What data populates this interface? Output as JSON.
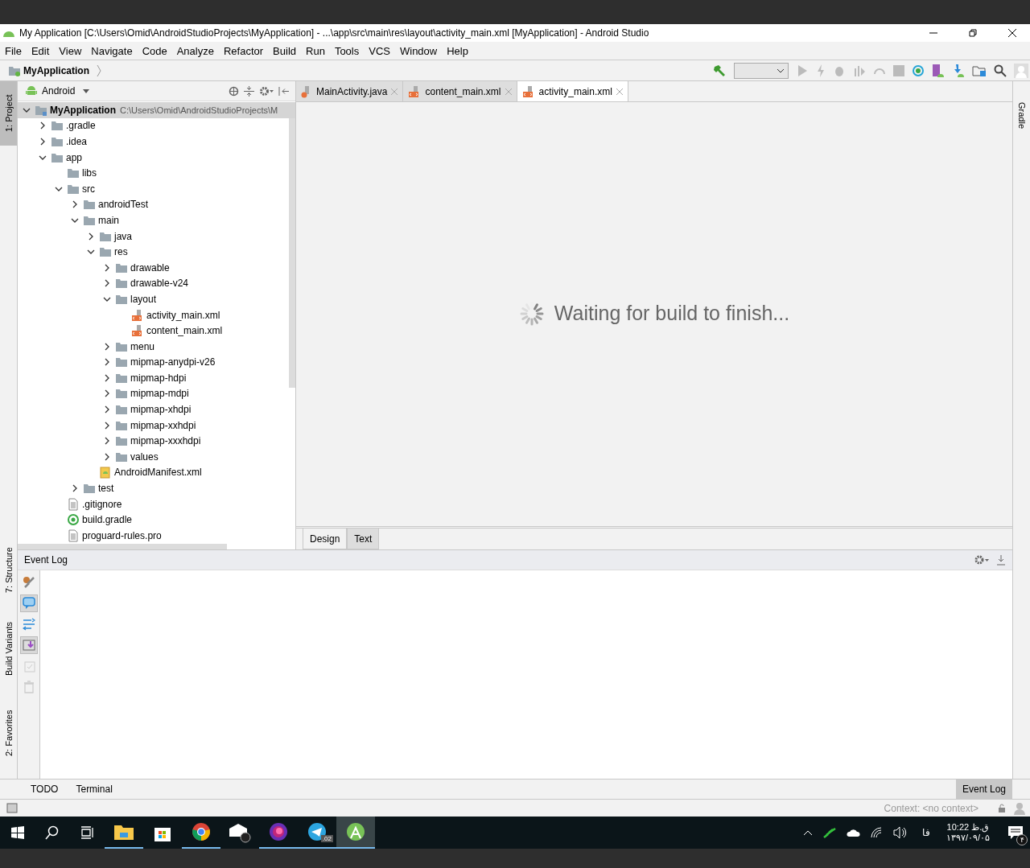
{
  "window": {
    "title": "My Application [C:\\Users\\Omid\\AndroidStudioProjects\\MyApplication] - ...\\app\\src\\main\\res\\layout\\activity_main.xml [MyApplication] - Android Studio"
  },
  "menu": [
    "File",
    "Edit",
    "View",
    "Navigate",
    "Code",
    "Analyze",
    "Refactor",
    "Build",
    "Run",
    "Tools",
    "VCS",
    "Window",
    "Help"
  ],
  "breadcrumb": "MyApplication",
  "left_strip": [
    {
      "label": "1: Project",
      "selected": true
    },
    {
      "label": "7: Structure",
      "selected": false
    },
    {
      "label": "Build Variants",
      "selected": false
    },
    {
      "label": "2: Favorites",
      "selected": false
    }
  ],
  "right_strip": [
    {
      "label": "Gradle",
      "selected": false
    }
  ],
  "project_panel": {
    "view": "Android",
    "tree": [
      {
        "label": "MyApplication",
        "path": "C:\\Users\\Omid\\AndroidStudioProjects\\M",
        "kind": "module",
        "expanded": true,
        "selected": true,
        "children": [
          {
            "label": ".gradle",
            "kind": "folder",
            "expanded": false
          },
          {
            "label": ".idea",
            "kind": "folder",
            "expanded": false
          },
          {
            "label": "app",
            "kind": "folder",
            "expanded": true,
            "children": [
              {
                "label": "libs",
                "kind": "folder"
              },
              {
                "label": "src",
                "kind": "folder",
                "expanded": true,
                "children": [
                  {
                    "label": "androidTest",
                    "kind": "folder",
                    "expanded": false
                  },
                  {
                    "label": "main",
                    "kind": "folder",
                    "expanded": true,
                    "children": [
                      {
                        "label": "java",
                        "kind": "folder",
                        "expanded": false
                      },
                      {
                        "label": "res",
                        "kind": "folder",
                        "expanded": true,
                        "children": [
                          {
                            "label": "drawable",
                            "kind": "folder",
                            "expanded": false
                          },
                          {
                            "label": "drawable-v24",
                            "kind": "folder",
                            "expanded": false
                          },
                          {
                            "label": "layout",
                            "kind": "folder",
                            "expanded": true,
                            "children": [
                              {
                                "label": "activity_main.xml",
                                "kind": "xml"
                              },
                              {
                                "label": "content_main.xml",
                                "kind": "xml"
                              }
                            ]
                          },
                          {
                            "label": "menu",
                            "kind": "folder",
                            "expanded": false
                          },
                          {
                            "label": "mipmap-anydpi-v26",
                            "kind": "folder",
                            "expanded": false
                          },
                          {
                            "label": "mipmap-hdpi",
                            "kind": "folder",
                            "expanded": false
                          },
                          {
                            "label": "mipmap-mdpi",
                            "kind": "folder",
                            "expanded": false
                          },
                          {
                            "label": "mipmap-xhdpi",
                            "kind": "folder",
                            "expanded": false
                          },
                          {
                            "label": "mipmap-xxhdpi",
                            "kind": "folder",
                            "expanded": false
                          },
                          {
                            "label": "mipmap-xxxhdpi",
                            "kind": "folder",
                            "expanded": false
                          },
                          {
                            "label": "values",
                            "kind": "folder",
                            "expanded": false
                          }
                        ]
                      },
                      {
                        "label": "AndroidManifest.xml",
                        "kind": "manifest"
                      }
                    ]
                  },
                  {
                    "label": "test",
                    "kind": "folder",
                    "expanded": false
                  }
                ]
              },
              {
                "label": ".gitignore",
                "kind": "text"
              },
              {
                "label": "build.gradle",
                "kind": "gradle"
              },
              {
                "label": "proguard-rules.pro",
                "kind": "text"
              }
            ]
          }
        ]
      }
    ]
  },
  "editor_tabs": [
    {
      "label": "MainActivity.java",
      "kind": "java",
      "selected": false
    },
    {
      "label": "content_main.xml",
      "kind": "xml",
      "selected": false
    },
    {
      "label": "activity_main.xml",
      "kind": "xml",
      "selected": true
    }
  ],
  "editor": {
    "message": "Waiting for build to finish..."
  },
  "design_tabs": [
    {
      "label": "Design",
      "selected": true
    },
    {
      "label": "Text",
      "selected": false
    }
  ],
  "event_log": {
    "title": "Event Log",
    "tools": [
      {
        "selected": false
      },
      {
        "selected": true
      },
      {
        "selected": false
      },
      {
        "selected": true
      },
      {
        "selected": false
      },
      {
        "selected": false
      }
    ]
  },
  "bottom_tabs": [
    {
      "label": "TODO",
      "selected": false
    },
    {
      "label": "Terminal",
      "selected": false
    },
    {
      "label": "Event Log",
      "selected": true
    }
  ],
  "status_bar": {
    "context": "Context: <no context>"
  },
  "taskbar": {
    "apps": [
      {
        "kind": "explorer",
        "running": true
      },
      {
        "kind": "store",
        "running": false
      },
      {
        "kind": "chrome",
        "running": true
      },
      {
        "kind": "mail",
        "running": false
      },
      {
        "kind": "media",
        "running": true
      },
      {
        "kind": "telegram",
        "running": true,
        "badge": ".02"
      },
      {
        "kind": "studio",
        "running": true
      }
    ],
    "language": "فا",
    "time": "10:22 ق.ظ",
    "date": "۱۳۹۷/۰۹/۰۵",
    "notifications": "۴"
  }
}
